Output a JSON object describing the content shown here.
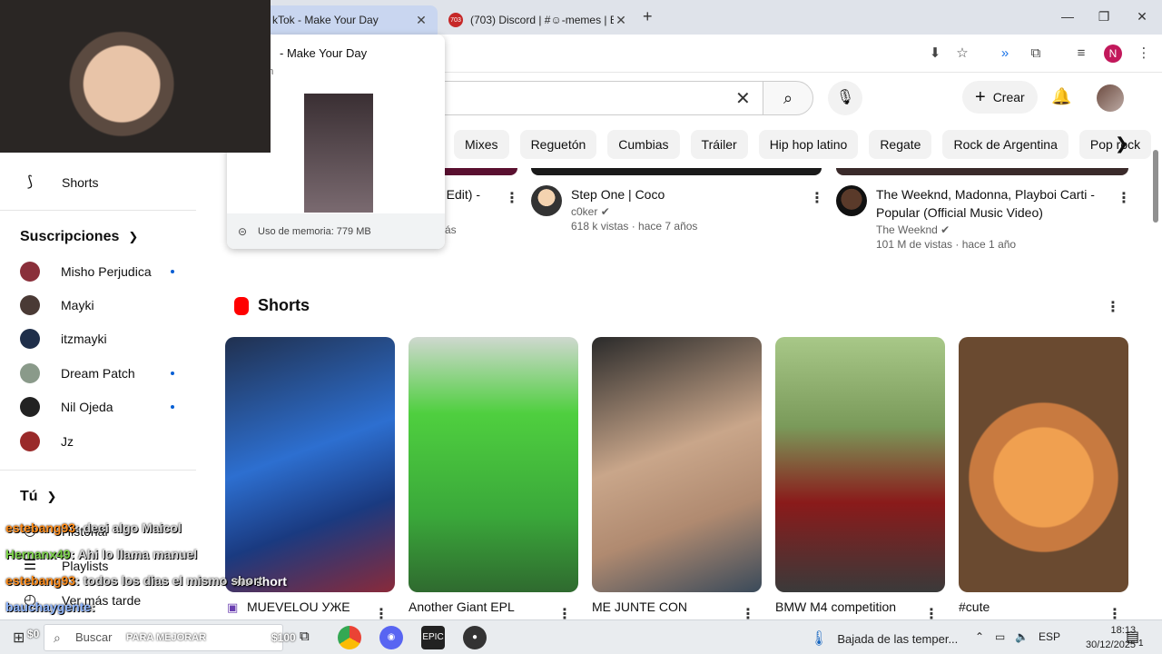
{
  "browser": {
    "active_tab_title": "kTok - Make Your Day",
    "inactive_tab_title": "(703) Discord | #☺-memes | El",
    "inactive_tab_badge": "703",
    "close_glyph": "✕",
    "new_tab_glyph": "+",
    "window_controls": [
      "—",
      "❐",
      "✕"
    ],
    "profile_initial": "N"
  },
  "memory_popover": {
    "title": "- Make Your Day",
    "domain": "om",
    "memory_label": "Uso de memoria: 779 MB"
  },
  "header": {
    "create_label": "Crear",
    "search_clear_glyph": "✕",
    "search_glyph": "⌕",
    "mic_glyph": "🎙",
    "bell_glyph": "🔔"
  },
  "chips": [
    "Mixes",
    "Reguetón",
    "Cumbias",
    "Tráiler",
    "Hip hop latino",
    "Regate",
    "Rock de Argentina",
    "Pop rock"
  ],
  "sidebar": {
    "shorts_label": "Shorts",
    "subscriptions_title": "Suscripciones",
    "subscriptions": [
      {
        "name": "Misho Perjudica",
        "new": true,
        "color": "#8a2f3a"
      },
      {
        "name": "Mayki",
        "new": false,
        "color": "#4a3a35"
      },
      {
        "name": "itzmayki",
        "new": false,
        "color": "#1f2f4a"
      },
      {
        "name": "Dream Patch",
        "new": true,
        "color": "#8a9a8a"
      },
      {
        "name": "Nil Ojeda",
        "new": true,
        "color": "#222222"
      },
      {
        "name": "Jz",
        "new": false,
        "color": "#9a2a2a"
      }
    ],
    "you_title": "Tú",
    "you_items": [
      "Historial",
      "Playlists",
      "Ver más tarde"
    ]
  },
  "videos": [
    {
      "title": "o Edit) -",
      "channel": "",
      "stats": "más"
    },
    {
      "title": "Step One | Coco",
      "channel": "c0ker",
      "stats": "618 k vistas · hace 7 años"
    },
    {
      "title": "The Weeknd, Madonna, Playboi Carti - Popular (Official Music Video)",
      "channel": "The Weeknd",
      "stats": "101 M de vistas · hace 1 año"
    }
  ],
  "shorts_section": {
    "title": "Shorts",
    "items": [
      {
        "title": "MUEVELOU УЖЕ",
        "overlay": "mo short"
      },
      {
        "title": "Another Giant EPL",
        "overlay": ""
      },
      {
        "title": "ME JUNTE CON",
        "overlay": ""
      },
      {
        "title": "BMW M4 competition",
        "overlay": ""
      },
      {
        "title": "#cute",
        "overlay": ""
      }
    ]
  },
  "chat": [
    {
      "user": "estebang93",
      "message": ": deci algo Maicol",
      "color": "orange"
    },
    {
      "user": "Hernanx49",
      "message": ": Ahi lo llama manuel",
      "color": "green"
    },
    {
      "user": "estebang93",
      "message": ": todos los dias el mismo short",
      "color": "orange"
    },
    {
      "user": "bauchaygente",
      "message": ":",
      "color": "blue"
    }
  ],
  "taskbar": {
    "search_placeholder": "Buscar",
    "promo_text": "PARA MEJORAR",
    "promo_price": "$100",
    "promo_price_left": "$0",
    "weather": "Bajada de las temper...",
    "language": "ESP",
    "time": "18:13",
    "date": "30/12/2025",
    "notification_count": "1"
  }
}
